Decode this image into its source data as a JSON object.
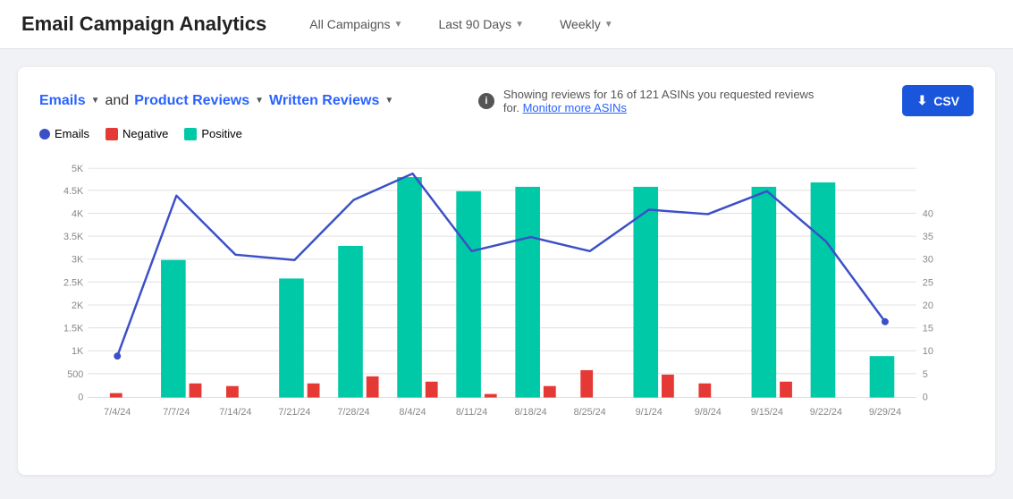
{
  "header": {
    "title": "Email Campaign Analytics",
    "filters": [
      {
        "id": "campaigns",
        "label": "All Campaigns"
      },
      {
        "id": "days",
        "label": "Last 90 Days"
      },
      {
        "id": "period",
        "label": "Weekly"
      }
    ]
  },
  "chart": {
    "title_emails": "Emails",
    "title_and": "and",
    "title_reviews": "Product Reviews",
    "title_written": "Written Reviews",
    "info_text": "Showing reviews for 16 of 121 ASINs you requested reviews for.",
    "monitor_link": "Monitor more ASINs",
    "csv_label": "CSV",
    "legend": [
      {
        "id": "emails",
        "label": "Emails",
        "color": "#3b4fc8"
      },
      {
        "id": "negative",
        "label": "Negative",
        "color": "#e53935"
      },
      {
        "id": "positive",
        "label": "Positive",
        "color": "#00c9a7"
      }
    ],
    "xLabels": [
      "7/4/24",
      "7/7/24",
      "7/14/24",
      "7/21/24",
      "7/28/24",
      "8/4/24",
      "8/11/24",
      "8/18/24",
      "8/25/24",
      "9/1/24",
      "9/8/24",
      "9/15/24",
      "9/22/24",
      "9/29/24"
    ],
    "yLeftLabels": [
      "0",
      "500",
      "1K",
      "1.5K",
      "2K",
      "2.5K",
      "3K",
      "3.5K",
      "4K",
      "4.5K",
      "5K"
    ],
    "yRightLabels": [
      "0",
      "5",
      "10",
      "15",
      "20",
      "25",
      "30",
      "35",
      "40"
    ],
    "bars": {
      "positive": [
        0,
        3000,
        0,
        2600,
        3300,
        4800,
        4500,
        4600,
        0,
        4600,
        0,
        4600,
        4700,
        900
      ],
      "negative": [
        100,
        300,
        250,
        300,
        450,
        350,
        80,
        250,
        600,
        500,
        300,
        350,
        0,
        0
      ]
    },
    "line": [
      900,
      4400,
      3100,
      3000,
      4300,
      4900,
      3200,
      3500,
      3200,
      4100,
      4000,
      4500,
      3400,
      1650
    ]
  }
}
